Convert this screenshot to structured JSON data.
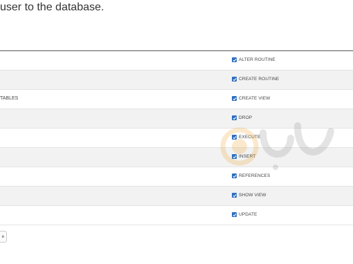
{
  "header": {
    "title": "user to the database."
  },
  "privileges": {
    "left_column": [
      "",
      "",
      "TABLES",
      "",
      "",
      "",
      "",
      "",
      ""
    ],
    "right_column": [
      {
        "label": "ALTER ROUTINE",
        "checked": true
      },
      {
        "label": "CREATE ROUTINE",
        "checked": true
      },
      {
        "label": "CREATE VIEW",
        "checked": true
      },
      {
        "label": "DROP",
        "checked": true
      },
      {
        "label": "EXECUTE",
        "checked": true
      },
      {
        "label": "INSERT",
        "checked": true
      },
      {
        "label": "REFERENCES",
        "checked": true
      },
      {
        "label": "SHOW VIEW",
        "checked": true
      },
      {
        "label": "UPDATE",
        "checked": true
      }
    ]
  },
  "actions": {
    "button_label": "e"
  },
  "colors": {
    "checkbox": "#2f6fc0",
    "row_shade": "#f2f2f2",
    "divider": "#555555"
  }
}
